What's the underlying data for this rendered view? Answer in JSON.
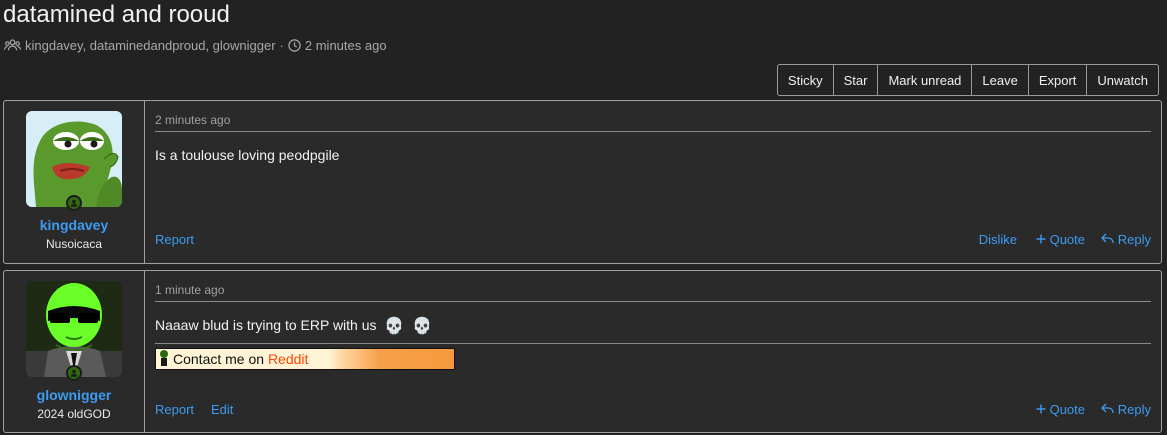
{
  "thread": {
    "title": "datamined and rooud",
    "participants": "kingdavey, dataminedandproud, glownigger",
    "time": "2 minutes ago"
  },
  "toolbar": {
    "buttons": [
      "Sticky",
      "Star",
      "Mark unread",
      "Leave",
      "Export",
      "Unwatch"
    ]
  },
  "posts": [
    {
      "username": "kingdavey",
      "user_title": "Nusoicaca",
      "timestamp": "2 minutes ago",
      "body": "Is a toulouse loving peodpgile",
      "actions_left": [
        "Report"
      ],
      "actions_right": {
        "dislike": "Dislike",
        "quote": "Quote",
        "reply": "Reply"
      }
    },
    {
      "username": "glownigger",
      "user_title": "2024 oldGOD",
      "timestamp": "1 minute ago",
      "body": "Naaaw blud is trying to ERP with us",
      "signature": {
        "prefix": "Contact me on ",
        "brand": "Reddit"
      },
      "actions_left": [
        "Report",
        "Edit"
      ],
      "actions_right": {
        "quote": "Quote",
        "reply": "Reply"
      }
    }
  ],
  "icons": {
    "users": "users-icon",
    "clock": "clock-icon",
    "plus": "plus-icon",
    "reply": "reply-icon",
    "skull": "skull-emoji",
    "online": "online-status-icon"
  },
  "colors": {
    "link": "#3d9bf0",
    "background": "#222222",
    "panel": "#2a2a2a",
    "online": "#2e6b10"
  }
}
